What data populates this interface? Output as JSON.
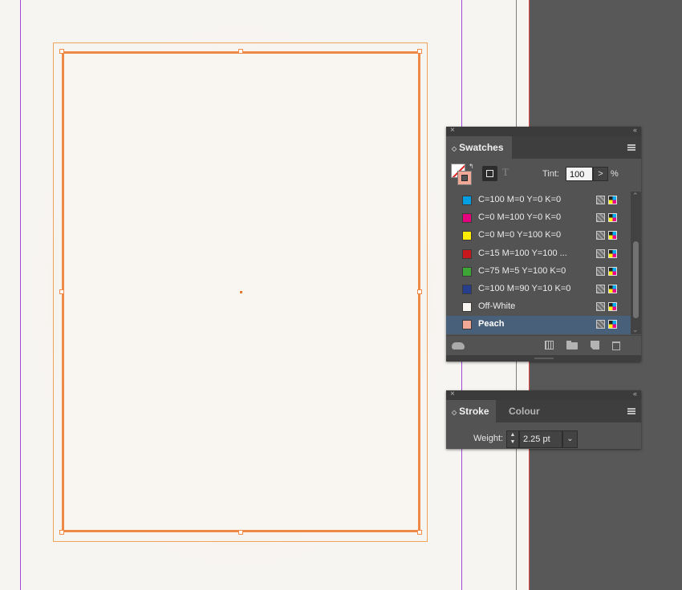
{
  "canvas": {
    "guide_color": "#a348d9",
    "frame_color": "#ee8a45"
  },
  "swatches_panel": {
    "close": "×",
    "collapse": "‹‹",
    "tab_label": "Swatches",
    "tab_arrows": "◇",
    "tint_label": "Tint:",
    "tint_value": "100",
    "tint_button": ">",
    "tint_unit": "%",
    "format_text": "T",
    "swap": "↰",
    "items": [
      {
        "name": "C=100 M=0 Y=0 K=0",
        "color": "#009fe3"
      },
      {
        "name": "C=0 M=100 Y=0 K=0",
        "color": "#e5007e"
      },
      {
        "name": "C=0 M=0 Y=100 K=0",
        "color": "#ffed00"
      },
      {
        "name": "C=15 M=100 Y=100 ...",
        "color": "#c8171d"
      },
      {
        "name": "C=75 M=5 Y=100 K=0",
        "color": "#3da436"
      },
      {
        "name": "C=100 M=90 Y=10 K=0",
        "color": "#263e8c"
      },
      {
        "name": "Off-White",
        "color": "#f9f6f2"
      },
      {
        "name": "Peach",
        "color": "#f2a897",
        "selected": true
      }
    ]
  },
  "stroke_panel": {
    "close": "×",
    "collapse": "‹‹",
    "tabs": [
      "Stroke",
      "Colour"
    ],
    "tab_arrows": "◇",
    "weight_label": "Weight:",
    "weight_value": "2.25 pt",
    "dropdown": "⌄",
    "stepper": "⌃⌄"
  }
}
